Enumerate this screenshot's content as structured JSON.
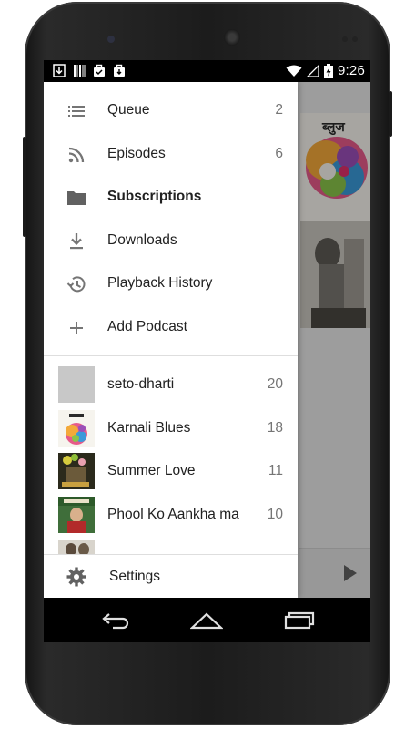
{
  "status_bar": {
    "time": "9:26",
    "left_icons": [
      "download-icon",
      "barcode-icon",
      "briefcase-icon",
      "briefcase-download-icon"
    ],
    "right_icons": [
      "wifi-icon",
      "signal-icon",
      "battery-charging-icon"
    ]
  },
  "drawer": {
    "nav_items": [
      {
        "label": "Queue",
        "count": "2",
        "icon": "queue-list-icon",
        "active": false
      },
      {
        "label": "Episodes",
        "count": "6",
        "icon": "rss-feed-icon",
        "active": false
      },
      {
        "label": "Subscriptions",
        "count": "",
        "icon": "folder-icon",
        "active": true
      },
      {
        "label": "Downloads",
        "count": "",
        "icon": "download-icon",
        "active": false
      },
      {
        "label": "Playback History",
        "count": "",
        "icon": "history-icon",
        "active": false
      },
      {
        "label": "Add Podcast",
        "count": "",
        "icon": "plus-icon",
        "active": false
      }
    ],
    "subscriptions": [
      {
        "label": "seto-dharti",
        "count": "20"
      },
      {
        "label": "Karnali Blues",
        "count": "18"
      },
      {
        "label": "Summer Love",
        "count": "11"
      },
      {
        "label": "Phool Ko Aankha ma",
        "count": "10"
      }
    ],
    "settings_label": "Settings"
  },
  "colors": {
    "accent_text": "#212121",
    "secondary_text": "#757575",
    "icon_gray": "#757575"
  }
}
